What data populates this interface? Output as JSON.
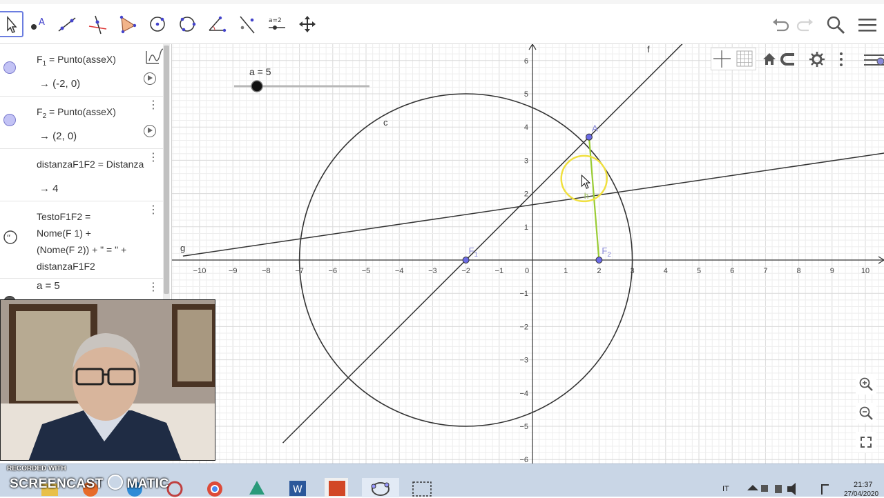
{
  "toolbar": {
    "tools": [
      {
        "name": "move-tool-icon"
      },
      {
        "name": "point-tool-icon"
      },
      {
        "name": "line-tool-icon"
      },
      {
        "name": "perpendicular-line-tool-icon"
      },
      {
        "name": "polygon-tool-icon"
      },
      {
        "name": "circle-center-point-tool-icon"
      },
      {
        "name": "circle-three-points-tool-icon"
      },
      {
        "name": "angle-tool-icon"
      },
      {
        "name": "reflect-tool-icon"
      },
      {
        "name": "slider-tool-icon",
        "label": "a=2"
      },
      {
        "name": "move-graphics-tool-icon"
      }
    ],
    "right_icons": [
      "undo-icon",
      "redo-icon",
      "search-icon",
      "hamburger-menu-icon"
    ]
  },
  "algebra": {
    "items": [
      {
        "def_name": "F",
        "def_sub": "1",
        "def_rest": " = Punto(asseX)",
        "value": "→  (-2, 0)",
        "marker_color": "#c3c3f5",
        "marker_border": "#7a7acc"
      },
      {
        "def_name": "F",
        "def_sub": "2",
        "def_rest": " = Punto(asseX)",
        "value": "→  (2, 0)",
        "marker_color": "#c3c3f5",
        "marker_border": "#7a7acc"
      },
      {
        "def": "distanzaF1F2  =  Distanza",
        "value": "→  4"
      },
      {
        "def_lines": [
          "TestoF1F2 =",
          "Nome(F 1) +",
          "(Nome(F 2)) + \" = \" +",
          "distanzaF1F2"
        ],
        "icon": "quote-icon"
      },
      {
        "def": "a = 5",
        "marker_color": "#555555",
        "marker_border": "#333333"
      }
    ]
  },
  "graphics": {
    "slider_label": "a = 5",
    "slider_value": 5,
    "slider_min": 0,
    "slider_max": 20,
    "circle_label": "c",
    "line_f_label": "f",
    "line_g_label": "g",
    "point_a_label": "A",
    "point_h_label": "h",
    "f1_label": "F",
    "f1_sub": "1",
    "f2_label": "F",
    "f2_sub": "2",
    "x_ticks": [
      "−10",
      "−9",
      "−8",
      "−7",
      "−6",
      "−5",
      "−4",
      "−3",
      "−2",
      "−1",
      "0",
      "1",
      "2",
      "3",
      "4",
      "5",
      "6",
      "7",
      "8",
      "9",
      "10"
    ],
    "y_ticks_pos": [
      "1",
      "2",
      "3",
      "4",
      "5",
      "6"
    ],
    "y_ticks_neg": [
      "−1",
      "−2",
      "−3",
      "−4",
      "−5",
      "−6"
    ],
    "style_bar_icons": [
      "axes-toggle-icon",
      "grid-toggle-icon",
      "home-icon",
      "magnet-icon",
      "settings-gear-icon",
      "more-vertical-icon"
    ],
    "zoom_icons": [
      "zoom-in-icon",
      "zoom-out-icon",
      "fullscreen-icon"
    ],
    "colors": {
      "grid_minor": "#eeeeee",
      "grid_major": "#dadada",
      "axis": "#333333",
      "curve": "#333333",
      "segment_h": "#99cc33",
      "point": "#6b6be6",
      "highlight": "#f0e040"
    }
  },
  "taskbar": {
    "watermark_line1": "RECORDED WITH",
    "watermark_line2": "SCREENCAST",
    "watermark_line3": "MATIC",
    "language": "IT",
    "time": "21:37",
    "date": "27/04/2020"
  }
}
